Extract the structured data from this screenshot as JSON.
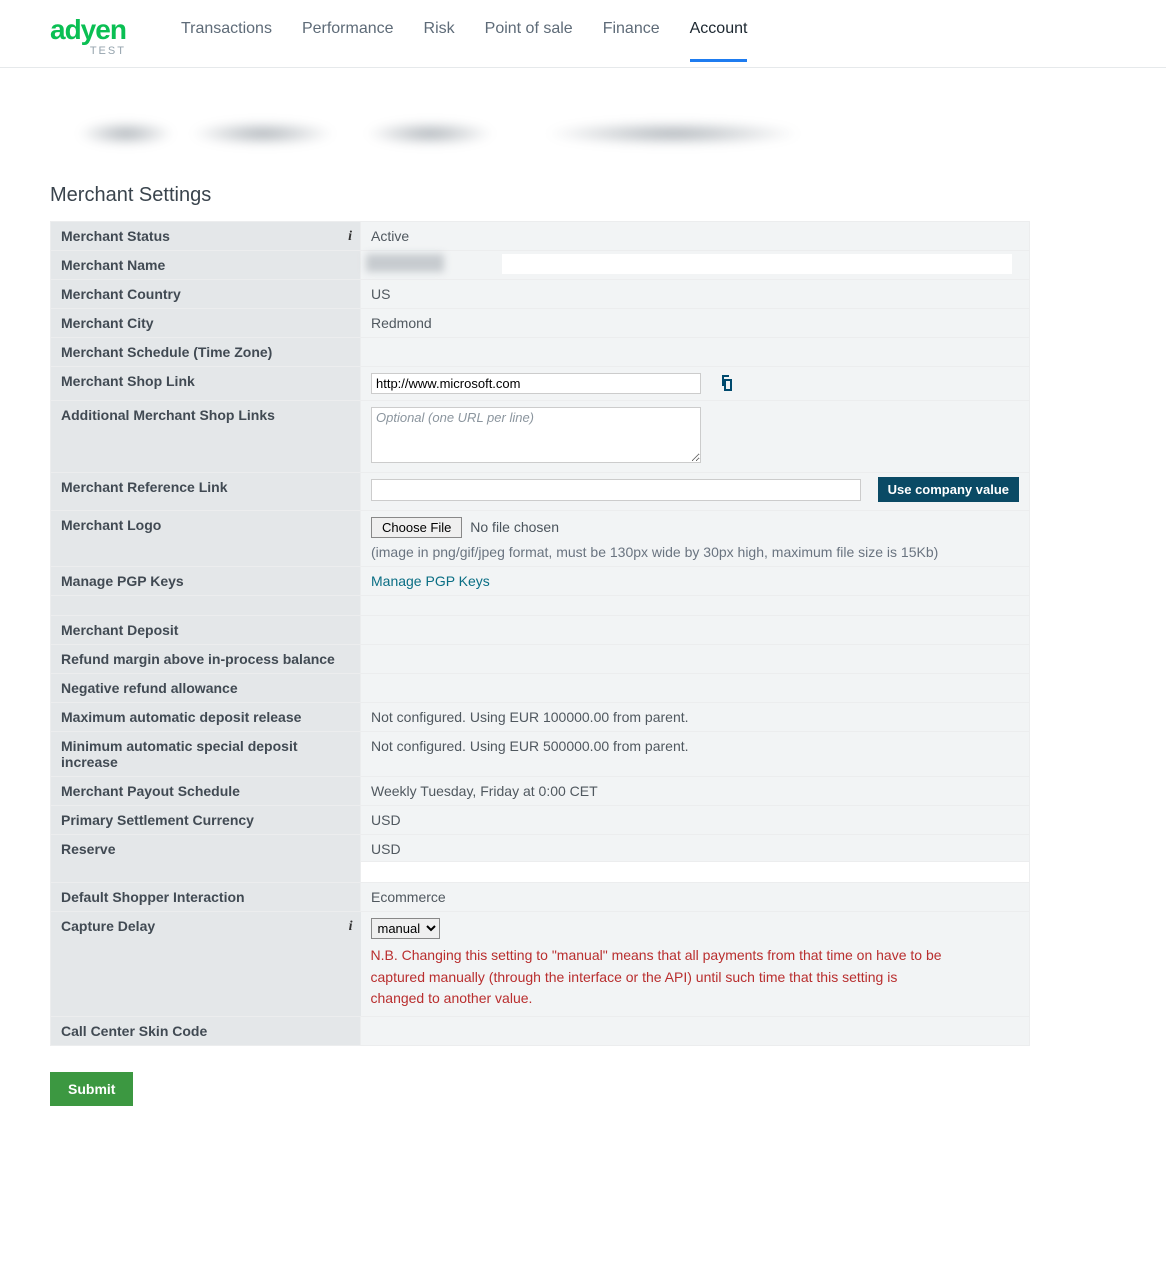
{
  "brand": {
    "name": "adyen",
    "env": "TEST"
  },
  "nav": {
    "items": [
      {
        "label": "Transactions",
        "active": false
      },
      {
        "label": "Performance",
        "active": false
      },
      {
        "label": "Risk",
        "active": false
      },
      {
        "label": "Point of sale",
        "active": false
      },
      {
        "label": "Finance",
        "active": false
      },
      {
        "label": "Account",
        "active": true
      }
    ]
  },
  "section_title": "Merchant Settings",
  "rows": {
    "status": {
      "label": "Merchant Status",
      "value": "Active",
      "info": true
    },
    "name": {
      "label": "Merchant Name"
    },
    "country": {
      "label": "Merchant Country",
      "value": "US"
    },
    "city": {
      "label": "Merchant City",
      "value": "Redmond"
    },
    "schedule": {
      "label": "Merchant Schedule (Time Zone)",
      "value": ""
    },
    "shop": {
      "label": "Merchant Shop Link",
      "value": "http://www.microsoft.com"
    },
    "addl": {
      "label": "Additional Merchant Shop Links",
      "placeholder": "Optional (one URL per line)"
    },
    "reflink": {
      "label": "Merchant Reference Link",
      "btn": "Use company value"
    },
    "logo": {
      "label": "Merchant Logo",
      "choose": "Choose File",
      "nofile": "No file chosen",
      "hint": "(image in png/gif/jpeg format, must be 130px wide by 30px high, maximum file size is 15Kb)"
    },
    "pgp": {
      "label": "Manage PGP Keys",
      "link": "Manage PGP Keys"
    },
    "deposit": {
      "label": "Merchant Deposit",
      "value": ""
    },
    "refundmargin": {
      "label": "Refund margin above in-process balance",
      "value": ""
    },
    "negrefund": {
      "label": "Negative refund allowance",
      "value": ""
    },
    "maxauto": {
      "label": "Maximum automatic deposit release",
      "value": "Not configured. Using EUR 100000.00 from parent."
    },
    "minauto": {
      "label": "Minimum automatic special deposit increase",
      "value": "Not configured. Using EUR 500000.00 from parent."
    },
    "payout": {
      "label": "Merchant Payout Schedule",
      "value": "Weekly Tuesday, Friday at 0:00 CET"
    },
    "currency": {
      "label": "Primary Settlement Currency",
      "value": "USD"
    },
    "reserve": {
      "label": "Reserve",
      "value": "USD"
    },
    "shopper": {
      "label": "Default Shopper Interaction",
      "value": "Ecommerce"
    },
    "capture": {
      "label": "Capture Delay",
      "info": true,
      "selected": "manual",
      "warning": "N.B. Changing this setting to \"manual\" means that all payments from that time on have to be captured manually (through the interface or the API) until such time that this setting is changed to another value."
    },
    "callcenter": {
      "label": "Call Center Skin Code",
      "value": ""
    }
  },
  "submit_label": "Submit"
}
